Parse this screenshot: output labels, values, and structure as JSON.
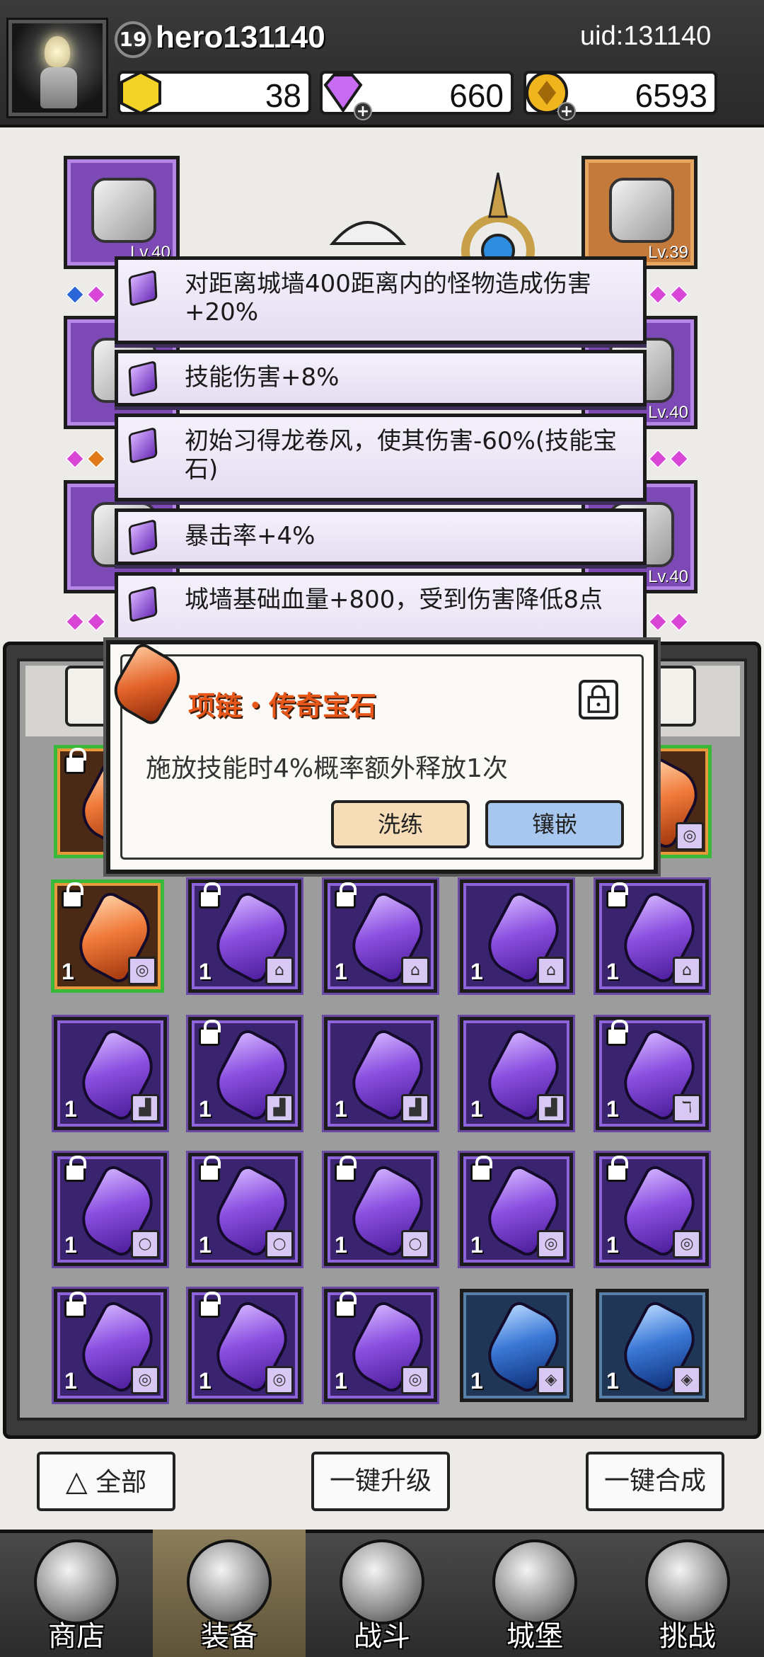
{
  "player": {
    "level": "19",
    "name": "hero131140",
    "uid": "uid:131140"
  },
  "currencies": [
    {
      "icon": "hexagon-gold-icon",
      "value": "38",
      "color": "#f3d326"
    },
    {
      "icon": "purple-diamond-icon",
      "value": "660",
      "color": "#c66bf2"
    },
    {
      "icon": "gold-coin-icon",
      "value": "6593",
      "color": "#f0b41c"
    }
  ],
  "equipment": {
    "slots": [
      {
        "name": "helmet",
        "level": "Lv.40",
        "rarity": "purple"
      },
      {
        "name": "pipe-weapon",
        "level": "Lv.39",
        "rarity": "orange"
      },
      {
        "name": "bracer",
        "level": "",
        "rarity": "purple"
      },
      {
        "name": "ring",
        "level": "Lv.40",
        "rarity": "purple"
      },
      {
        "name": "boots",
        "level": "",
        "rarity": "purple"
      },
      {
        "name": "necklace",
        "level": "Lv.40",
        "rarity": "purple"
      }
    ]
  },
  "stats_tooltip": [
    "对距离城墙400距离内的怪物造成伤害+20%",
    "技能伤害+8%",
    "初始习得龙卷风，使其伤害-60%(技能宝石)",
    "暴击率+4%",
    "城墙基础血量+800，受到伤害降低8点"
  ],
  "detail": {
    "title": "项链・传奇宝石",
    "description": "施放技能时4%概率额外释放1次",
    "reforge_label": "洗练",
    "inlay_label": "镶嵌"
  },
  "bag": {
    "count_label": "1",
    "rows": [
      [
        {
          "type": "legend",
          "locked": true,
          "slot_icon": "necklace-icon"
        },
        {
          "type": "purple",
          "locked": true,
          "slot_icon": "armor-icon"
        },
        {
          "type": "purple",
          "locked": true,
          "slot_icon": "armor-icon"
        },
        {
          "type": "purple",
          "locked": false,
          "slot_icon": "armor-icon"
        },
        {
          "type": "purple",
          "locked": true,
          "slot_icon": "armor-icon"
        }
      ],
      [
        {
          "type": "purple",
          "locked": false,
          "slot_icon": "boot-icon"
        },
        {
          "type": "purple",
          "locked": true,
          "slot_icon": "boot-icon"
        },
        {
          "type": "purple",
          "locked": false,
          "slot_icon": "boot-icon"
        },
        {
          "type": "purple",
          "locked": false,
          "slot_icon": "boot-icon"
        },
        {
          "type": "purple",
          "locked": true,
          "slot_icon": "pipe-icon"
        }
      ],
      [
        {
          "type": "purple",
          "locked": true,
          "slot_icon": "ring-icon"
        },
        {
          "type": "purple",
          "locked": true,
          "slot_icon": "ring-icon"
        },
        {
          "type": "purple",
          "locked": true,
          "slot_icon": "ring-icon"
        },
        {
          "type": "purple",
          "locked": true,
          "slot_icon": "necklace-icon"
        },
        {
          "type": "purple",
          "locked": true,
          "slot_icon": "necklace-icon"
        }
      ],
      [
        {
          "type": "purple",
          "locked": true,
          "slot_icon": "necklace-icon"
        },
        {
          "type": "purple",
          "locked": true,
          "slot_icon": "necklace-icon"
        },
        {
          "type": "purple",
          "locked": true,
          "slot_icon": "necklace-icon"
        },
        {
          "type": "blue",
          "locked": false,
          "slot_icon": "shield-icon"
        },
        {
          "type": "blue",
          "locked": false,
          "slot_icon": "shield-icon"
        }
      ]
    ]
  },
  "actions": {
    "filter_label": "全部",
    "upgrade_all_label": "一键升级",
    "merge_all_label": "一键合成"
  },
  "nav": [
    {
      "label": "商店",
      "icon": "shop-house-icon",
      "active": false
    },
    {
      "label": "装备",
      "icon": "backpack-icon",
      "active": true
    },
    {
      "label": "战斗",
      "icon": "crossed-swords-icon",
      "active": false
    },
    {
      "label": "城堡",
      "icon": "castle-icon",
      "active": false
    },
    {
      "label": "挑战",
      "icon": "helmet-icon",
      "active": false
    }
  ]
}
